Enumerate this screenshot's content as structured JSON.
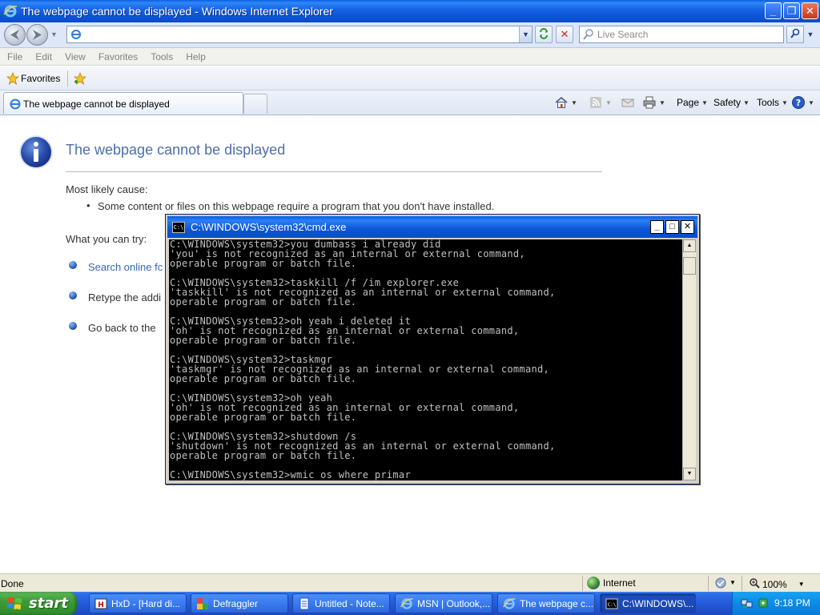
{
  "window": {
    "title": "The webpage cannot be displayed - Windows Internet Explorer"
  },
  "address_bar": {
    "url": "",
    "search_placeholder": "Live Search"
  },
  "menu": [
    "File",
    "Edit",
    "View",
    "Favorites",
    "Tools",
    "Help"
  ],
  "favorites_bar": {
    "label": "Favorites"
  },
  "tab": {
    "label": "The webpage cannot be displayed"
  },
  "command_bar": {
    "page": "Page",
    "safety": "Safety",
    "tools": "Tools"
  },
  "page": {
    "title": "The webpage cannot be displayed",
    "cause_heading": "Most likely cause:",
    "cause_item": "Some content or files on this webpage require a program that you don't have installed.",
    "try_heading": "What you can try:",
    "options": [
      "Search online fc",
      "Retype the addi",
      "Go back to the"
    ]
  },
  "cmd": {
    "title": "C:\\WINDOWS\\system32\\cmd.exe",
    "lines": [
      "C:\\WINDOWS\\system32>you dumbass i already did",
      "'you' is not recognized as an internal or external command,",
      "operable program or batch file.",
      "",
      "C:\\WINDOWS\\system32>taskkill /f /im explorer.exe",
      "'taskkill' is not recognized as an internal or external command,",
      "operable program or batch file.",
      "",
      "C:\\WINDOWS\\system32>oh yeah i deleted it",
      "'oh' is not recognized as an internal or external command,",
      "operable program or batch file.",
      "",
      "C:\\WINDOWS\\system32>taskmgr",
      "'taskmgr' is not recognized as an internal or external command,",
      "operable program or batch file.",
      "",
      "C:\\WINDOWS\\system32>oh yeah",
      "'oh' is not recognized as an internal or external command,",
      "operable program or batch file.",
      "",
      "C:\\WINDOWS\\system32>shutdown /s",
      "'shutdown' is not recognized as an internal or external command,",
      "operable program or batch file.",
      "",
      "C:\\WINDOWS\\system32>wmic os where primar"
    ]
  },
  "status_bar": {
    "text": "Done",
    "zone": "Internet",
    "zoom": "100%"
  },
  "taskbar": {
    "start_label": "start",
    "tasks": [
      {
        "label": "HxD - [Hard di..."
      },
      {
        "label": "Defraggler"
      },
      {
        "label": "Untitled - Note..."
      },
      {
        "label": "MSN | Outlook,..."
      },
      {
        "label": "The webpage c..."
      },
      {
        "label": "C:\\WINDOWS\\..."
      }
    ],
    "clock": "9:18 PM"
  },
  "colors": {
    "xp_blue": "#0b55d6",
    "link_blue": "#3566b5",
    "title_blue": "#4e6eab",
    "start_green": "#3c9d36"
  }
}
